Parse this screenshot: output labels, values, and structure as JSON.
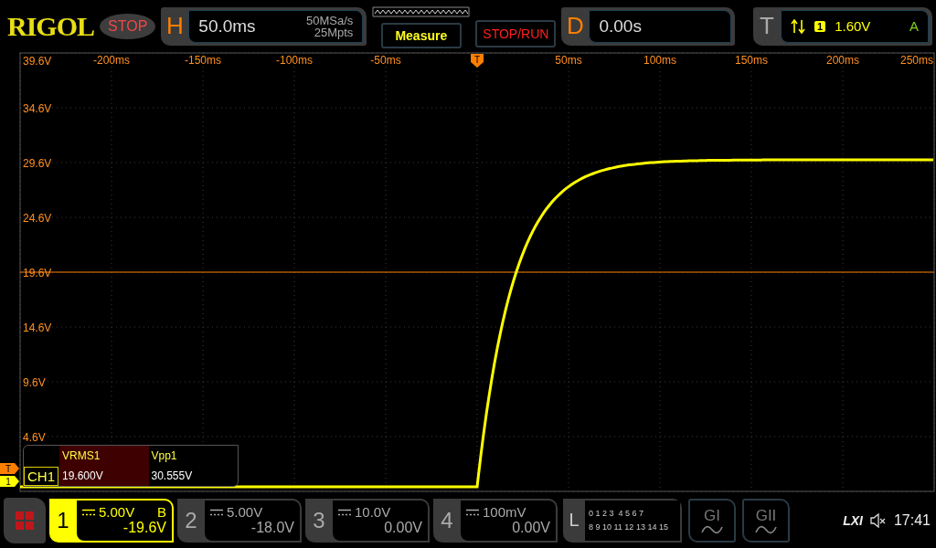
{
  "header": {
    "logo": "RIGOL",
    "run_state": "STOP",
    "horizontal": {
      "label": "H",
      "timebase": "50.0ms",
      "sample_rate": "50MSa/s",
      "memory_depth": "25Mpts"
    },
    "measure_button": "Measure",
    "stop_run_button": "STOP/RUN",
    "delay": {
      "label": "D",
      "value": "0.00s"
    },
    "trigger": {
      "label": "T",
      "channel": "1",
      "level": "1.60V",
      "mode": "A"
    }
  },
  "display": {
    "time_labels": [
      "-200ms",
      "-150ms",
      "-100ms",
      "-50ms",
      "50ms",
      "100ms",
      "150ms",
      "200ms",
      "250ms"
    ],
    "voltage_labels": [
      "39.6V",
      "34.6V",
      "29.6V",
      "24.6V",
      "19.6V",
      "14.6V",
      "9.6V",
      "4.6V"
    ],
    "trigger_marker": "T",
    "trigger_level_marker": "T",
    "channel_marker": "1",
    "measurements": {
      "channel": "CH1",
      "items": [
        {
          "name": "VRMS1",
          "value": "19.600V",
          "selected": true
        },
        {
          "name": "Vpp1",
          "value": "30.555V",
          "selected": false
        }
      ]
    }
  },
  "channels": [
    {
      "number": "1",
      "scale": "5.00V",
      "offset": "-19.6V",
      "bandwidth_limit": "B",
      "on": true
    },
    {
      "number": "2",
      "scale": "5.00V",
      "offset": "-18.0V",
      "on": false
    },
    {
      "number": "3",
      "scale": "10.0V",
      "offset": "0.00V",
      "on": false
    },
    {
      "number": "4",
      "scale": "100mV",
      "offset": "0.00V",
      "on": false
    }
  ],
  "logic": {
    "label": "L",
    "row_1": "0 1 2 3  4 5 6 7",
    "row_2": "8 9 10 11 12 13 14 15"
  },
  "generators": [
    "GI",
    "GII"
  ],
  "status": {
    "lxi": "LXI",
    "time": "17:41"
  }
}
